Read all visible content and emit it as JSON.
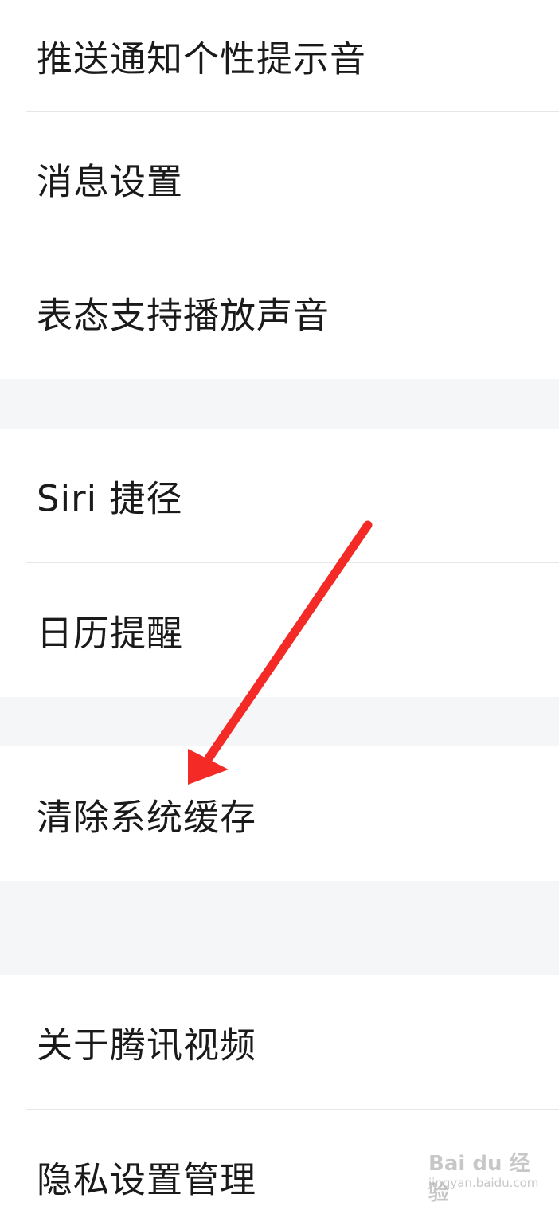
{
  "settings": {
    "items": [
      {
        "label": "推送通知个性提示音"
      },
      {
        "label": "消息设置"
      },
      {
        "label": "表态支持播放声音"
      },
      {
        "label": "Siri 捷径"
      },
      {
        "label": "日历提醒"
      },
      {
        "label": "清除系统缓存"
      },
      {
        "label": "关于腾讯视频"
      },
      {
        "label": "隐私设置管理"
      }
    ]
  },
  "annotation": {
    "arrow_color": "#f42a26",
    "arrow_icon": "red-arrow-icon"
  },
  "watermark": {
    "logo": "Bai du 经验",
    "url": "jingyan.baidu.com"
  },
  "colors": {
    "background": "#ffffff",
    "group_gap": "#f5f6f8",
    "divider": "#e6e6e6",
    "text": "#1a1a1a"
  }
}
